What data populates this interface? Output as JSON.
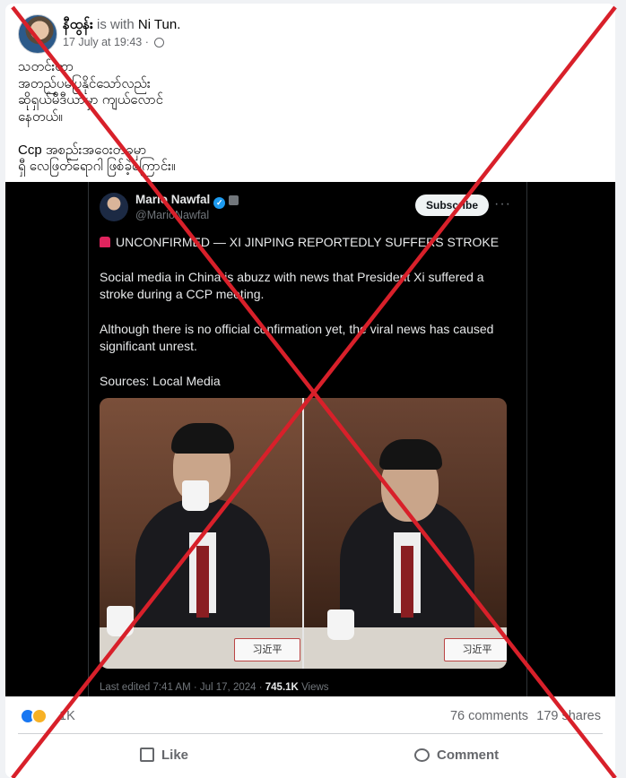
{
  "post": {
    "author": "နီထွန်း",
    "with_prefix": "is with",
    "tagged": "Ni Tun.",
    "timestamp": "17 July at 19:43 ·",
    "privacy_icon": "globe-icon",
    "text": "သတင်းဟာ\nအတည်ပမပြုနိုင်သော်လည်း\nဆိုရှယ်မီဒီယာမှာ ကျယ်လောင်\nနေတယ်။\n\nCcp အစည်းအဝေးတခုမှာ\nရှီ လေဖြတ်ရောဂါ ဖြစ်ခဲ့ကြောင်း။"
  },
  "tweet": {
    "name": "Mario Nawfal",
    "handle": "@MarioNawfal",
    "subscribe_label": "Subscribe",
    "more_label": "···",
    "headline": "UNCONFIRMED — XI JINPING REPORTEDLY SUFFERS STROKE",
    "para1": "Social media in China is abuzz with news that President Xi suffered a stroke during a CCP meeting.",
    "para2": "Although there is no official confirmation yet, the viral news has caused significant unrest.",
    "sources": "Sources: Local Media",
    "nameplate": "习近平",
    "edited": "Last edited 7:41 AM · Jul 17, 2024 ·",
    "views_count": "745.1K",
    "views_label": "Views"
  },
  "stats": {
    "reactions_count": "1K",
    "comments": "76 comments",
    "shares": "179 shares"
  },
  "actions": {
    "like": "Like",
    "comment": "Comment"
  },
  "overlay": {
    "type": "false-claim-x",
    "color": "#d8202a"
  }
}
